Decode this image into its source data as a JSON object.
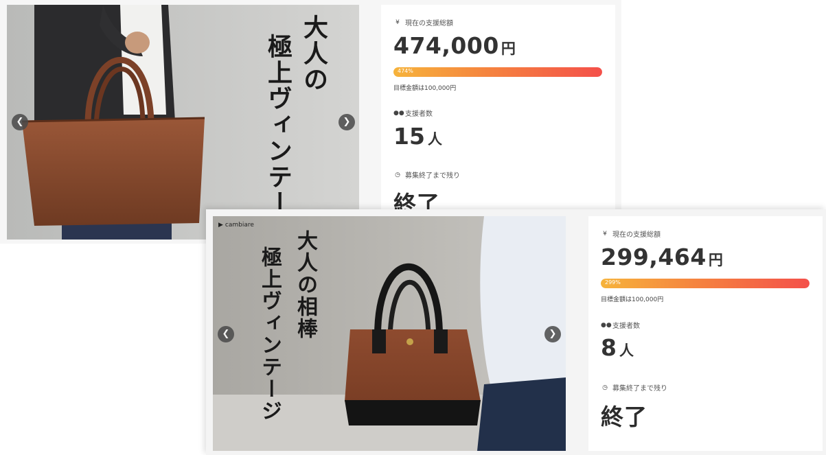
{
  "projects": [
    {
      "catch_lines": [
        "大人の",
        "極上ヴィンテージ"
      ],
      "prev_icon": "chevron-left-icon",
      "next_icon": "chevron-right-icon",
      "total_label": "現在の支援総額",
      "amount": "474,000",
      "amount_unit": "円",
      "progress_pct": 474,
      "progress_label": "474%",
      "goal_text": "目標金額は100,000円",
      "supporters_label": "支援者数",
      "supporters": "15",
      "supporters_unit": "人",
      "remaining_label": "募集終了まで残り",
      "remaining_value": "終了"
    },
    {
      "brand": "cambiare",
      "catch_lines": [
        "大人の相棒",
        "極上ヴィンテージ"
      ],
      "prev_icon": "chevron-left-icon",
      "next_icon": "chevron-right-icon",
      "total_label": "現在の支援総額",
      "amount": "299,464",
      "amount_unit": "円",
      "progress_pct": 299,
      "progress_label": "299%",
      "goal_text": "目標金額は100,000円",
      "supporters_label": "支援者数",
      "supporters": "8",
      "supporters_unit": "人",
      "remaining_label": "募集終了まで残り",
      "remaining_value": "終了"
    }
  ],
  "colors": {
    "bar_start": "#f6b33b",
    "bar_end": "#f4504a",
    "leather": "#8a4a2e"
  }
}
